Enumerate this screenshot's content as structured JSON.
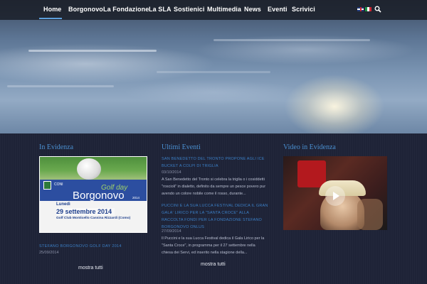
{
  "nav": {
    "items": [
      {
        "label": "Home",
        "active": true
      },
      {
        "label": "Borgonovo"
      },
      {
        "label": "La Fondazione"
      },
      {
        "label": "La SLA"
      },
      {
        "label": "Sostienici"
      },
      {
        "label": "Multimedia"
      },
      {
        "label": "News"
      },
      {
        "label": "Eventi"
      },
      {
        "label": "Scrivici"
      }
    ],
    "languages": [
      "english-flag-icon",
      "italian-flag-icon"
    ],
    "search_icon": "search-icon",
    "accent_color": "#5d9fdc"
  },
  "evidenza": {
    "title": "In Evidenza",
    "promo": {
      "event_name": "Golf day",
      "brand": "Borgonovo",
      "year": "2014",
      "weekday": "Lunedì",
      "date": "29 settembre 2014",
      "venue": "Golf Club Monticello Cassina Rizzardi (Como)",
      "logo_text": "CONI"
    },
    "article_title": "STEFANO BORGONOVO GOLF DAY 2014",
    "article_date": "25/09/2014",
    "more_link": "mostra tutti"
  },
  "eventi": {
    "title": "Ultimi Eventi",
    "items": [
      {
        "title": "SAN BENEDETTO DEL TRONTO PROPONE AGLI ICE BUCKET A COLPI DI TRIGLIA",
        "date": "03/10/2014",
        "excerpt": "A San Benedetto del Tronto si celebra la triglia o i cosiddetti \"roscioli\" in dialetto, definito da sempre un pesce povero pur avendo un colore nobile come il rosso, durante..."
      },
      {
        "title": "PUCCINI E LA SUA LUCCA FESTIVAL DEDICA IL GRAN GALA' LIRICO PER LA \"SANTA CROCE\" ALLA RACCOLTA FONDI PER LA FONDAZIONE STEFANO BORGONOVO ONLUS",
        "date": "27/09/2014",
        "excerpt": "Il Puccini e la sua Lucca Festival dedica il Gala Lirico per la \"Santa Croce\", in programma per il 27 settembre nella chiesa dei Servi, ed inserito nella stagione della..."
      }
    ],
    "more_link": "mostra tutti"
  },
  "video": {
    "title": "Video in Evidenza",
    "play_icon": "play-icon"
  }
}
